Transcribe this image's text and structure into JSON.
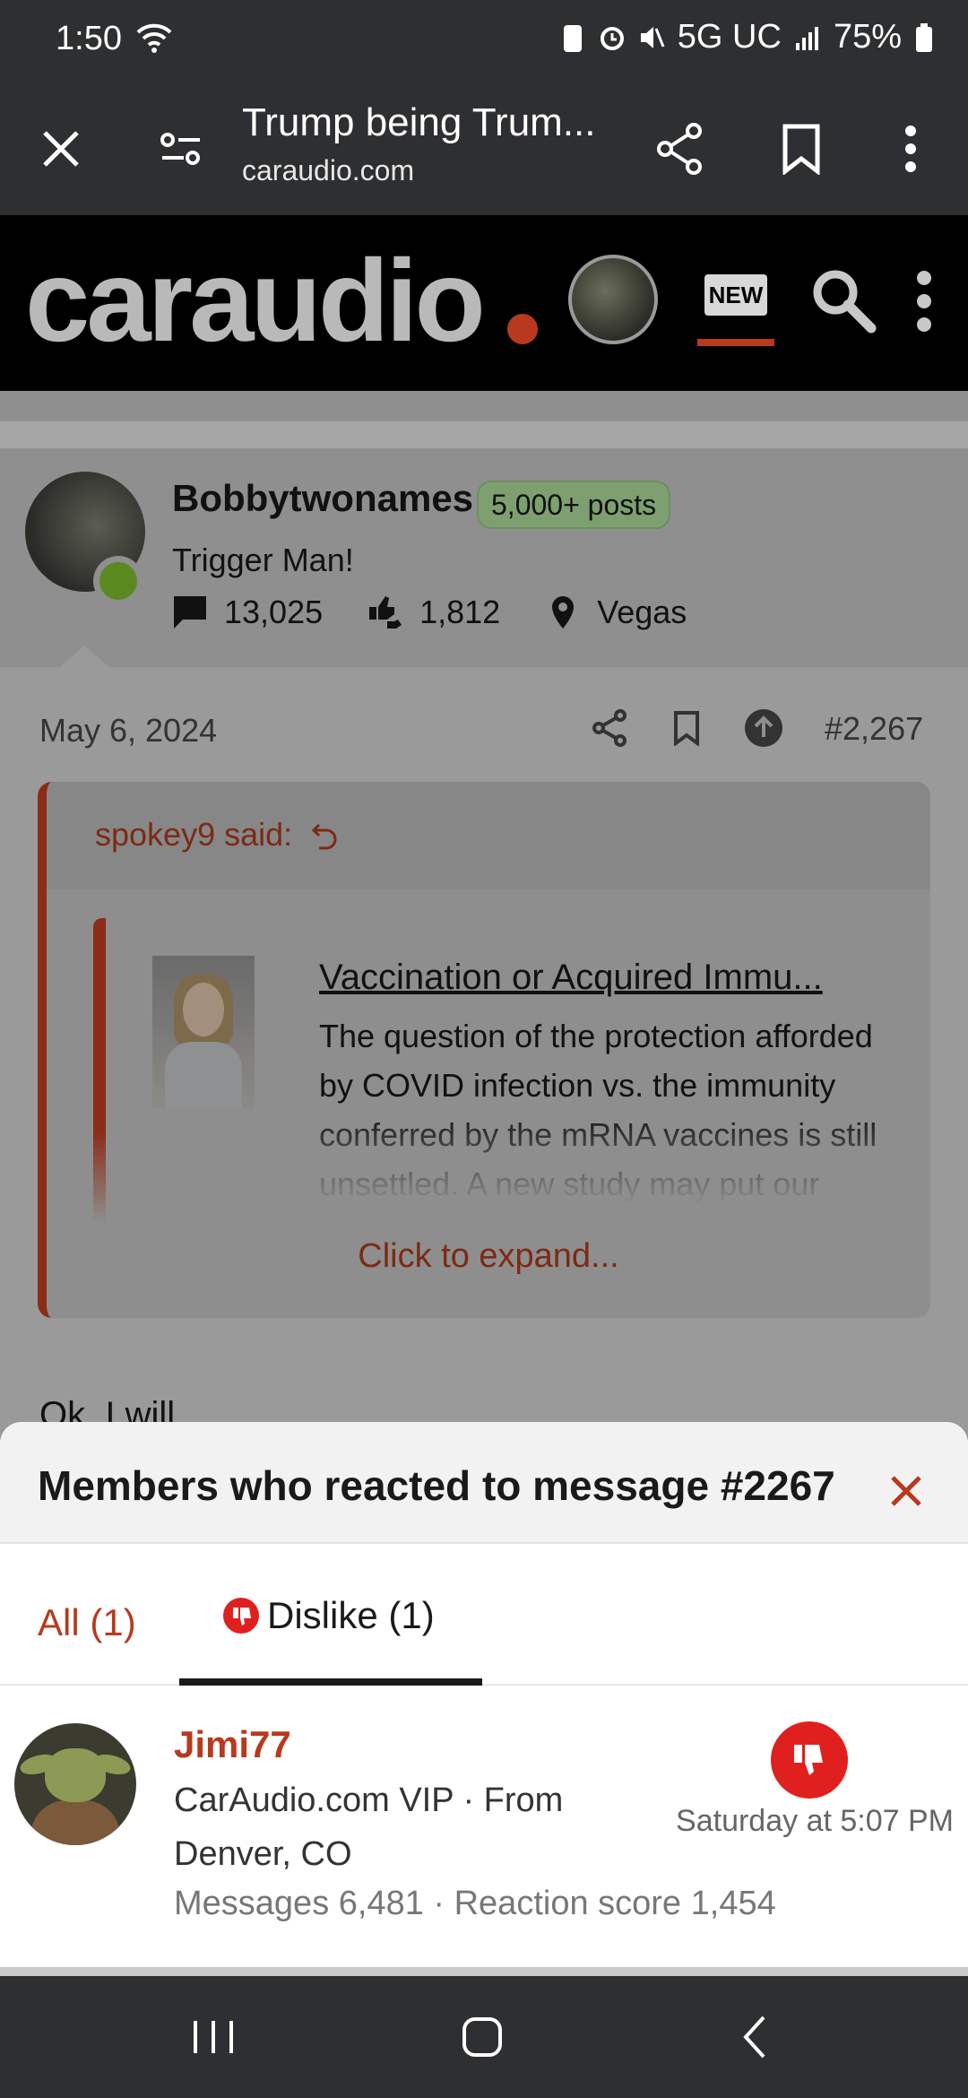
{
  "status_bar": {
    "time": "1:50",
    "network": "5G UC",
    "battery": "75%"
  },
  "browser": {
    "title": "Trump being Trum...",
    "url": "caraudio.com"
  },
  "site": {
    "logo": "caraudio",
    "new_label": "NEW"
  },
  "post_author": {
    "name": "Bobbytwonames",
    "badge": "5,000+ posts",
    "title": "Trigger Man!",
    "messages": "13,025",
    "reactions": "1,812",
    "location": "Vegas"
  },
  "post": {
    "date": "May 6, 2024",
    "number": "#2,267",
    "quote_author": "spokey9 said:",
    "embed_title": "Vaccination or Acquired Immu...",
    "embed_text": "The question of the protection afforded by COVID infection vs. the immunity conferred by the mRNA vaccines is still unsettled. A new study may put our concerns to rest",
    "expand_label": "Click to expand...",
    "body_partial": "Ok, I will"
  },
  "reactions_sheet": {
    "title": "Members who reacted to message #2267",
    "tabs": [
      {
        "label": "All (1)"
      },
      {
        "label": "Dislike (1)"
      }
    ],
    "members": [
      {
        "name": "Jimi77",
        "subtitle": "CarAudio.com VIP · From Denver, CO",
        "stats": "Messages  6,481 · Reaction score  1,454",
        "time": "Saturday at 5:07 PM",
        "reaction": "Dislike"
      }
    ]
  },
  "colors": {
    "accent": "#b8391d",
    "dislike_red": "#e0201f",
    "dark_chrome": "#2e2f31"
  }
}
